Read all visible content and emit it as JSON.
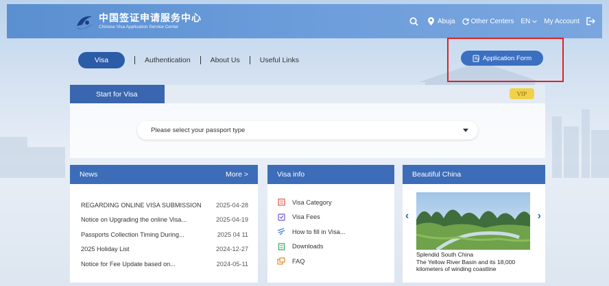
{
  "header": {
    "logo_cn": "中国签证申请服务中心",
    "logo_en": "Chinese Visa Application Service Center",
    "location": "Abuja",
    "other_centers": "Other Centers",
    "language": "EN",
    "my_account": "My Account"
  },
  "nav": {
    "visa": "Visa",
    "authentication": "Authentication",
    "about_us": "About Us",
    "useful_links": "Useful Links",
    "application_form": "Application Form"
  },
  "visa_card": {
    "tab": "Start for Visa",
    "vip": "VIP",
    "passport_placeholder": "Please select your passport type"
  },
  "news": {
    "title": "News",
    "more": "More >",
    "items": [
      {
        "title": "REGARDING ONLINE VISA SUBMISSION",
        "date": "2025-04-28"
      },
      {
        "title": "Notice on Upgrading the online Visa...",
        "date": "2025-04-19"
      },
      {
        "title": "Passports Collection Timing During...",
        "date": "2025 04 11"
      },
      {
        "title": "2025 Holiday List",
        "date": "2024-12-27"
      },
      {
        "title": "Notice for Fee Update based on...",
        "date": "2024-05-11"
      }
    ]
  },
  "visa_info": {
    "title": "Visa info",
    "items": [
      {
        "label": "Visa Category",
        "icon": "category-icon",
        "color": "#e0574a"
      },
      {
        "label": "Visa Fees",
        "icon": "fees-icon",
        "color": "#6a5acd"
      },
      {
        "label": "How to fill in Visa...",
        "icon": "pen-icon",
        "color": "#3a7bd5"
      },
      {
        "label": "Downloads",
        "icon": "download-icon",
        "color": "#3aa55a"
      },
      {
        "label": "FAQ",
        "icon": "faq-icon",
        "color": "#e08a2a"
      }
    ]
  },
  "china": {
    "title": "Beautiful China",
    "caption_title": "Splendid South China",
    "caption_text": "The Yellow River Basin and its 18,000 kilometers of winding coastline"
  },
  "colors": {
    "primary": "#3d6db8",
    "header": "#6c9ddb",
    "highlight": "#e0201f",
    "vip": "#f1d14a"
  }
}
